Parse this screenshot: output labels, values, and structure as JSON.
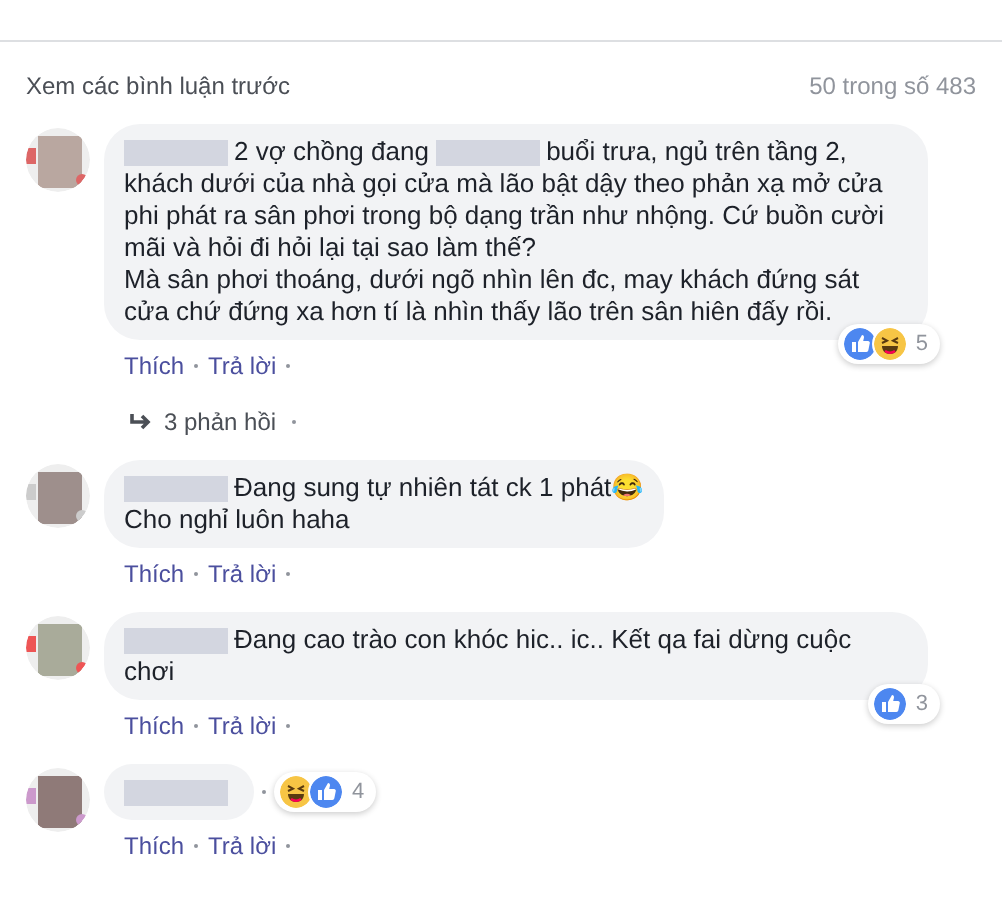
{
  "header": {
    "previous_link": "Xem các bình luận trước",
    "count": "50 trong số 483"
  },
  "comments": [
    {
      "paragraphs": [
        [
          {
            "kind": "redacted"
          },
          {
            "kind": "text",
            "text": "2 vợ chồng đang"
          },
          {
            "kind": "redacted"
          },
          {
            "kind": "text",
            "text": "buổi trưa, ngủ trên tầng 2, khách dưới của nhà gọi cửa mà lão bật dậy theo phản xạ mở cửa phi phát ra sân phơi trong bộ dạng trần như nhộng. Cứ buồn cười mãi và hỏi đi hỏi lại tại sao làm thế?"
          }
        ],
        [
          {
            "kind": "text",
            "text": "Mà sân phơi thoáng, dưới ngõ nhìn lên đc, may khách đứng sát cửa chứ đứng xa hơn tí là nhìn thấy lão trên sân hiên đấy rồi."
          }
        ]
      ],
      "reactions": [
        {
          "kind": "like"
        },
        {
          "kind": "haha"
        }
      ],
      "reaction_count": "5",
      "actions": [
        "Thích",
        "Trả lời"
      ],
      "replies": "3 phản hồi"
    },
    {
      "paragraphs": [
        [
          {
            "kind": "redacted"
          },
          {
            "kind": "text",
            "text": "Đang sung tự nhiên tát ck 1 phát😂"
          }
        ],
        [
          {
            "kind": "text",
            "text": "Cho nghỉ luôn haha"
          }
        ]
      ],
      "actions": [
        "Thích",
        "Trả lời"
      ]
    },
    {
      "paragraphs": [
        [
          {
            "kind": "redacted"
          },
          {
            "kind": "text",
            "text": "Đang cao trào con khóc hic.. ic.. Kết qa fai dừng cuộc chơi"
          }
        ]
      ],
      "reactions": [
        {
          "kind": "like"
        }
      ],
      "reaction_count": "3",
      "actions": [
        "Thích",
        "Trả lời"
      ]
    },
    {
      "paragraphs": [
        [
          {
            "kind": "redacted"
          }
        ]
      ],
      "reactions": [
        {
          "kind": "haha"
        },
        {
          "kind": "like"
        }
      ],
      "reaction_count": "4",
      "inline_reactions": true,
      "actions": [
        "Thích",
        "Trả lời"
      ]
    }
  ]
}
